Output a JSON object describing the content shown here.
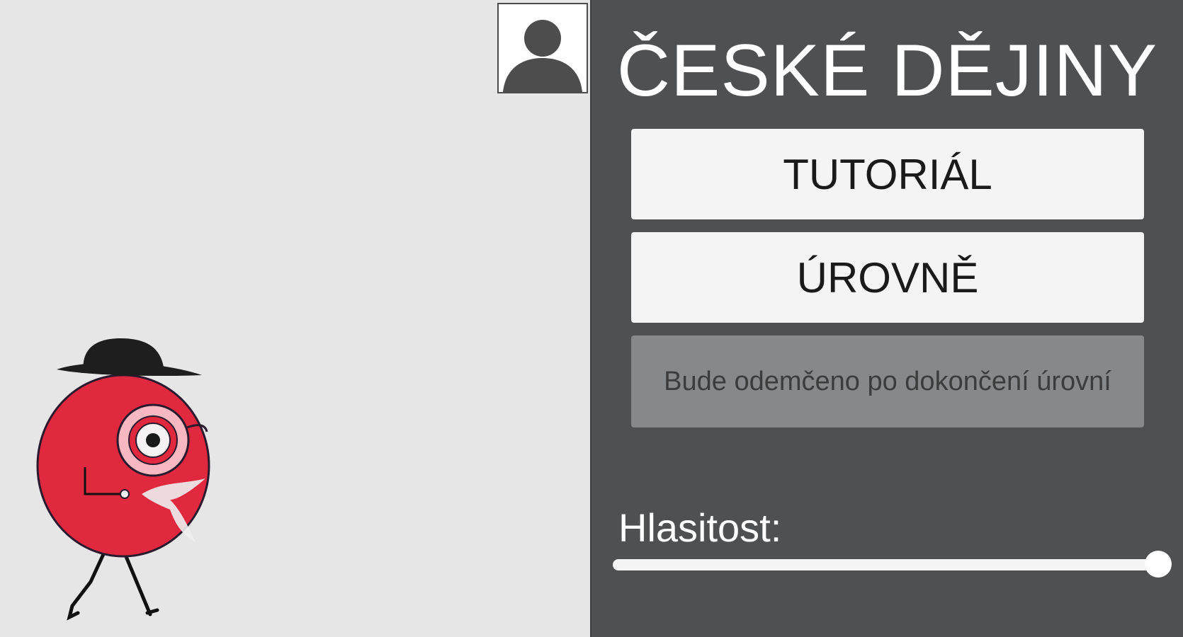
{
  "game": {
    "title": "ČESKÉ DĚJINY"
  },
  "menu": {
    "tutorial_label": "TUTORIÁL",
    "levels_label": "ÚROVNĚ",
    "locked_label": "Bude odemčeno po dokončení úrovní"
  },
  "settings": {
    "volume_label": "Hlasitost:",
    "volume_value": 1.0
  },
  "icons": {
    "avatar": "user-silhouette-icon"
  },
  "colors": {
    "panel_background": "#4f5052",
    "scene_background": "#e6e6e6",
    "button_background": "#f4f4f4",
    "locked_button_background": "#878889",
    "character_body": "#e0283f"
  }
}
